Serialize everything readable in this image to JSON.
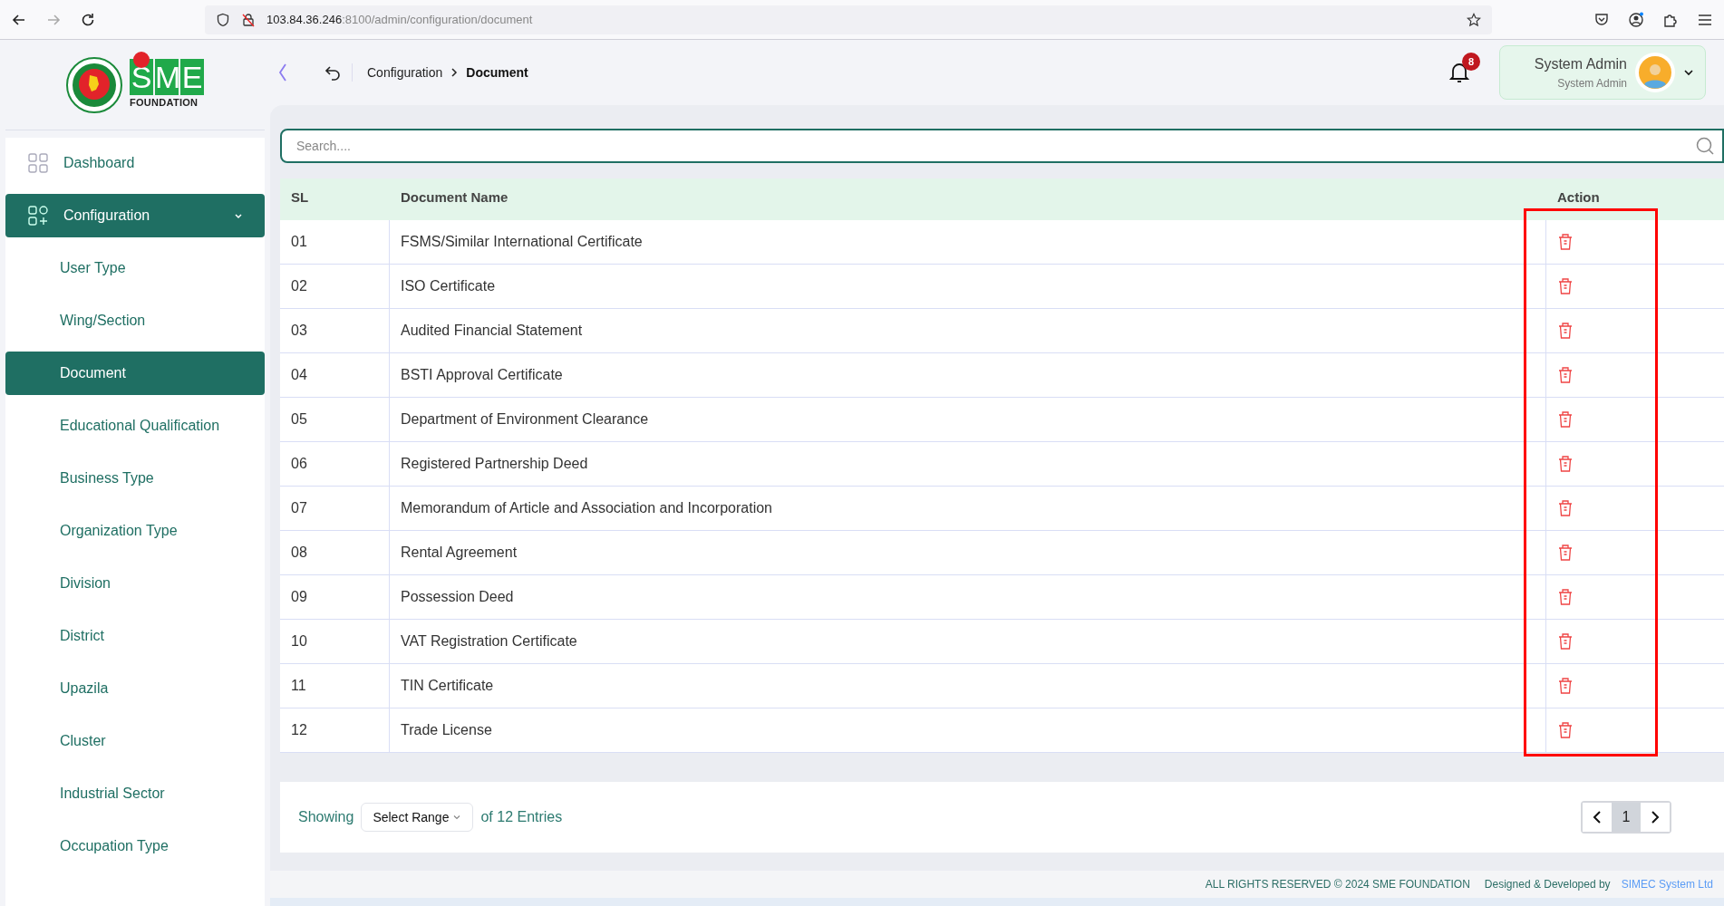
{
  "browser": {
    "url_host": "103.84.36.246",
    "url_path": ":8100/admin/configuration/document"
  },
  "header": {
    "logo_text": "SME",
    "logo_subtext": "FOUNDATION",
    "breadcrumb": [
      "Configuration",
      "Document"
    ],
    "notifications": "8",
    "user": {
      "name": "System Admin",
      "role": "System Admin"
    }
  },
  "sidebar": {
    "items": [
      {
        "label": "Dashboard",
        "selected": false
      },
      {
        "label": "Configuration",
        "selected": true,
        "expanded": true,
        "children": [
          {
            "label": "User Type",
            "selected": false
          },
          {
            "label": "Wing/Section",
            "selected": false
          },
          {
            "label": "Document",
            "selected": true
          },
          {
            "label": "Educational Qualification",
            "selected": false
          },
          {
            "label": "Business Type",
            "selected": false
          },
          {
            "label": "Organization Type",
            "selected": false
          },
          {
            "label": "Division",
            "selected": false
          },
          {
            "label": "District",
            "selected": false
          },
          {
            "label": "Upazila",
            "selected": false
          },
          {
            "label": "Cluster",
            "selected": false
          },
          {
            "label": "Industrial Sector",
            "selected": false
          },
          {
            "label": "Occupation Type",
            "selected": false
          }
        ]
      }
    ]
  },
  "search": {
    "placeholder": "Search...."
  },
  "table": {
    "columns": [
      "SL",
      "Document Name",
      "Action"
    ],
    "rows": [
      {
        "sl": "01",
        "name": "FSMS/Similar International Certificate"
      },
      {
        "sl": "02",
        "name": "ISO Certificate"
      },
      {
        "sl": "03",
        "name": "Audited Financial Statement"
      },
      {
        "sl": "04",
        "name": "BSTI Approval Certificate"
      },
      {
        "sl": "05",
        "name": "Department of Environment Clearance"
      },
      {
        "sl": "06",
        "name": "Registered Partnership Deed"
      },
      {
        "sl": "07",
        "name": "Memorandum of Article and Association and Incorporation"
      },
      {
        "sl": "08",
        "name": "Rental Agreement"
      },
      {
        "sl": "09",
        "name": "Possession Deed"
      },
      {
        "sl": "10",
        "name": "VAT Registration Certificate"
      },
      {
        "sl": "11",
        "name": "TIN Certificate"
      },
      {
        "sl": "12",
        "name": "Trade License"
      }
    ]
  },
  "pagination": {
    "showing": "Showing",
    "range_select": "Select Range",
    "entries": "of 12 Entries",
    "pages": [
      {
        "label": "1",
        "selected": true
      }
    ]
  },
  "footer": {
    "rights": "ALL RIGHTS RESERVED © 2024 SME FOUNDATION",
    "designed": "Designed & Developed by",
    "developer": "SIMEC System Ltd"
  }
}
